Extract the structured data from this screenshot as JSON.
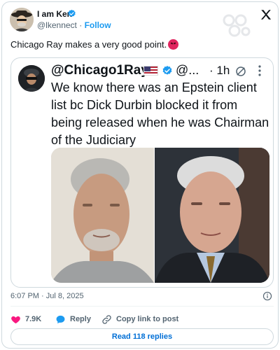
{
  "author": {
    "name": "I am Ken",
    "handle": "@lkennect",
    "separator": "·",
    "follow_label": "Follow"
  },
  "tweet": {
    "text": "Chicago Ray makes a very good point.",
    "emoji": "angry-face-emoji"
  },
  "quoted": {
    "handle": "@Chicago1Ray",
    "user_trail": "@...",
    "time": "· 1h",
    "text": "We know there was an Epstein client list bc Dick Durbin blocked it from being released when he was Chairman of the Judiciary"
  },
  "meta": {
    "timestamp": "6:07 PM · Jul 8, 2025"
  },
  "actions": {
    "likes": "7.9K",
    "reply_label": "Reply",
    "copy_label": "Copy link to post",
    "read_replies_label": "Read 118 replies"
  },
  "colors": {
    "link_blue": "#1d9bf0",
    "verified_blue": "#1d9bf0",
    "like_red": "#f91880",
    "reply_blue": "#1d9bf0",
    "read_link": "#006fd6",
    "secondary_text": "#536471"
  },
  "icons": {
    "brand": "x-logo-icon",
    "verified": "verified-badge-icon",
    "like": "heart-icon",
    "reply": "speech-bubble-icon",
    "copy": "link-icon",
    "info": "info-icon",
    "more": "more-vertical-icon"
  }
}
